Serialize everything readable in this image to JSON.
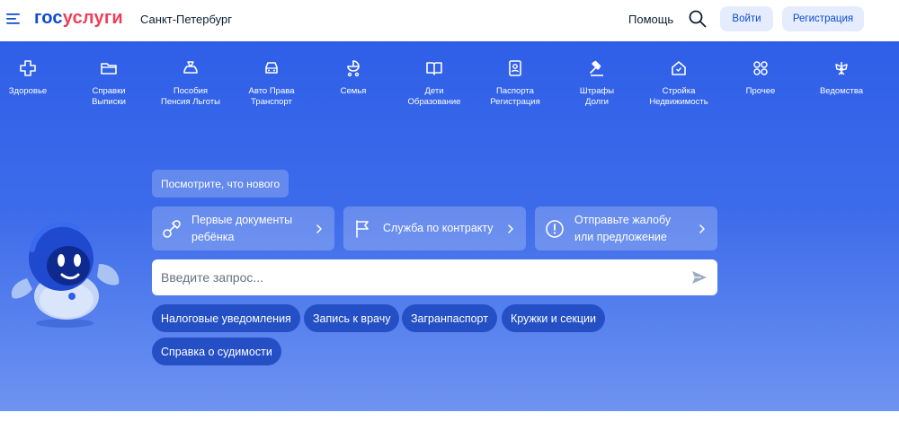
{
  "header": {
    "logo_part1": "гос",
    "logo_part2": "услуги",
    "city": "Санкт-Петербург",
    "help": "Помощь",
    "login": "Войти",
    "register": "Регистрация"
  },
  "categories": [
    {
      "label": "Здоровье",
      "icon": "health-cross-icon"
    },
    {
      "label": "Справки\nВыписки",
      "icon": "folder-icon"
    },
    {
      "label": "Пособия\nПенсия Льготы",
      "icon": "wallet-icon"
    },
    {
      "label": "Авто Права\nТранспорт",
      "icon": "car-icon"
    },
    {
      "label": "Семья",
      "icon": "stroller-icon"
    },
    {
      "label": "Дети\nОбразование",
      "icon": "book-icon"
    },
    {
      "label": "Паспорта\nРегистрация",
      "icon": "passport-icon"
    },
    {
      "label": "Штрафы\nДолги",
      "icon": "gavel-icon"
    },
    {
      "label": "Стройка\nНедвижимость",
      "icon": "house-icon"
    },
    {
      "label": "Прочее",
      "icon": "grid-icon"
    },
    {
      "label": "Ведомства",
      "icon": "eagle-emblem-icon"
    }
  ],
  "hero": {
    "whats_new": "Посмотрите, что нового",
    "cards": [
      {
        "label": "Первые документы\nребёнка",
        "icon": "pacifier-icon"
      },
      {
        "label": "Служба по контракту",
        "icon": "flag-icon"
      },
      {
        "label": "Отправьте жалобу\nили предложение",
        "icon": "alert-circle-icon"
      }
    ],
    "search_placeholder": "Введите запрос...",
    "search_value": "",
    "chips": [
      "Налоговые уведомления",
      "Запись к врачу",
      "Загранпаспорт",
      "Кружки и секции",
      "Справка о судимости"
    ]
  },
  "colors": {
    "brand_blue": "#0d4cd3",
    "brand_red": "#ee3f58",
    "hero_top": "#2f5fe8",
    "hero_bottom": "#6e93f1",
    "chip_bg": "#244fc5",
    "button_bg": "#e4ecfd"
  }
}
